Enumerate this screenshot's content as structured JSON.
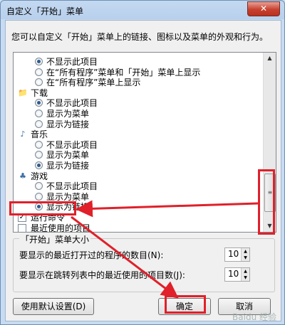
{
  "window": {
    "title": "自定义「开始」菜单",
    "close_glyph": "✕"
  },
  "description": "您可以自定义「开始」菜单上的链接、图标以及菜单的外观和行为。",
  "list": {
    "rows": [
      {
        "kind": "radio",
        "label": "不显示此项目",
        "checked": true
      },
      {
        "kind": "radio",
        "label": "在“所有程序”菜单和「开始」菜单上显示",
        "checked": false
      },
      {
        "kind": "radio",
        "label": "在“所有程序”菜单上显示",
        "checked": false
      },
      {
        "kind": "category",
        "label": "下载",
        "icon": "folder-icon"
      },
      {
        "kind": "radio",
        "label": "不显示此项目",
        "checked": true
      },
      {
        "kind": "radio",
        "label": "显示为菜单",
        "checked": false
      },
      {
        "kind": "radio",
        "label": "显示为链接",
        "checked": false
      },
      {
        "kind": "category",
        "label": "音乐",
        "icon": "music-icon"
      },
      {
        "kind": "radio",
        "label": "不显示此项目",
        "checked": false
      },
      {
        "kind": "radio",
        "label": "显示为菜单",
        "checked": false
      },
      {
        "kind": "radio",
        "label": "显示为链接",
        "checked": true
      },
      {
        "kind": "category",
        "label": "游戏",
        "icon": "games-icon"
      },
      {
        "kind": "radio",
        "label": "不显示此项目",
        "checked": false
      },
      {
        "kind": "radio",
        "label": "显示为菜单",
        "checked": false
      },
      {
        "kind": "radio",
        "label": "显示为链接",
        "checked": true
      },
      {
        "kind": "checkbox",
        "label": "运行命令",
        "checked": true
      },
      {
        "kind": "checkbox",
        "label": "最近使用的项目",
        "checked": false
      }
    ]
  },
  "size_group": {
    "title": "「开始」菜单大小",
    "recent_programs_label": "要显示的最近打开过的程序的数目(N):",
    "recent_programs_value": "10",
    "jump_list_label": "要显示在跳转列表中的最近使用的项目数(J):",
    "jump_list_value": "10"
  },
  "buttons": {
    "defaults": "使用默认设置(D)",
    "ok": "确定",
    "cancel": "取消"
  },
  "watermark": "Baidu 经验",
  "colors": {
    "annotation": "#e0202a",
    "accent": "#2f5a8a"
  }
}
